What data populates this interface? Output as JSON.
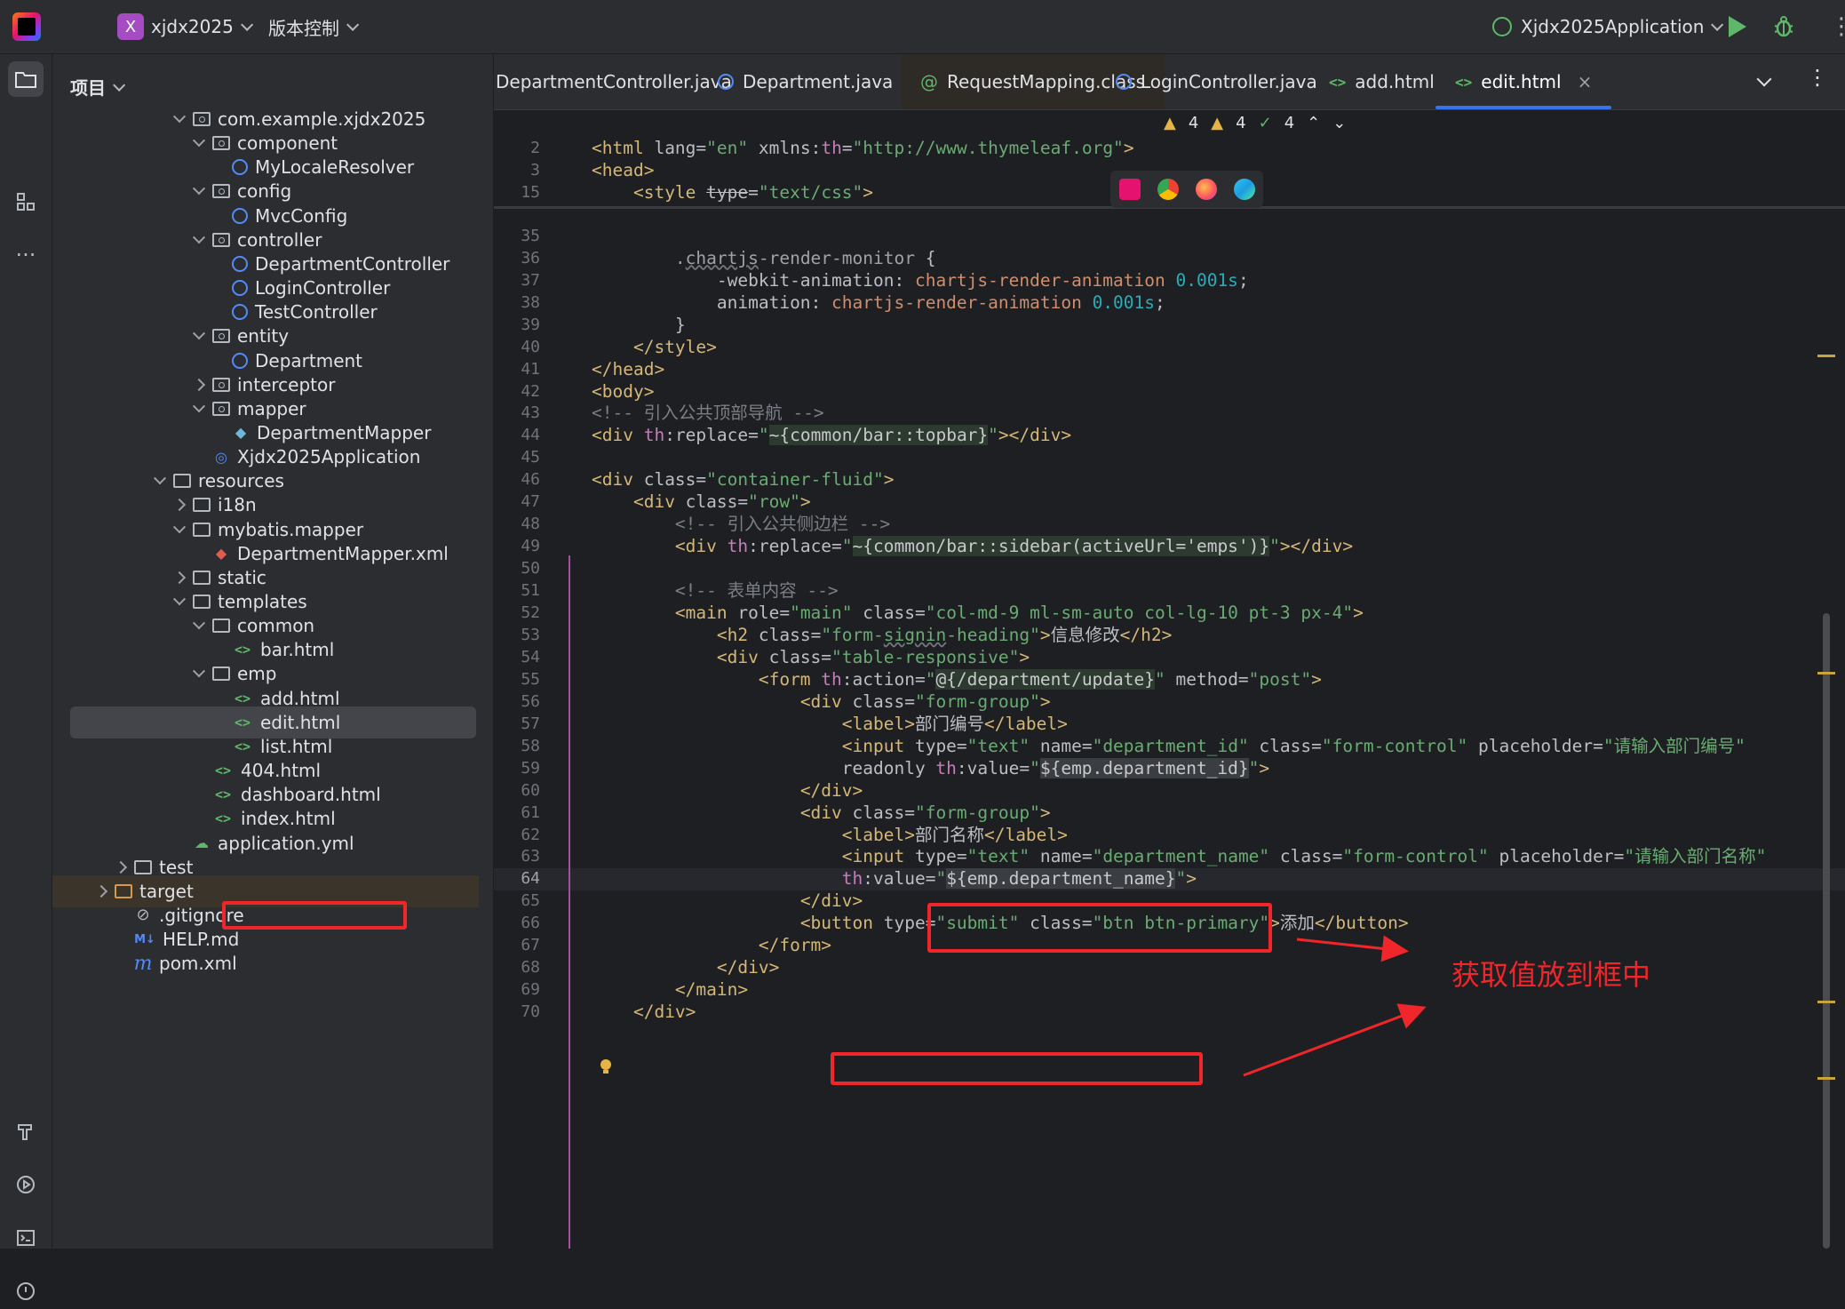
{
  "titlebar": {
    "project_badge": "X",
    "project_name": "xjdx2025",
    "vcs_label": "版本控制",
    "run_config": "Xjdx2025Application"
  },
  "project_panel": {
    "title": "项目",
    "tree": [
      {
        "label": "com.example.xjdx2025",
        "depth": 2,
        "arrow": "down",
        "icon": "package-folder"
      },
      {
        "label": "component",
        "depth": 3,
        "arrow": "down",
        "icon": "package-folder"
      },
      {
        "label": "MyLocaleResolver",
        "depth": 4,
        "arrow": "none",
        "icon": "class"
      },
      {
        "label": "config",
        "depth": 3,
        "arrow": "down",
        "icon": "package-folder"
      },
      {
        "label": "MvcConfig",
        "depth": 4,
        "arrow": "none",
        "icon": "class"
      },
      {
        "label": "controller",
        "depth": 3,
        "arrow": "down",
        "icon": "package-folder"
      },
      {
        "label": "DepartmentController",
        "depth": 4,
        "arrow": "none",
        "icon": "class"
      },
      {
        "label": "LoginController",
        "depth": 4,
        "arrow": "none",
        "icon": "class"
      },
      {
        "label": "TestController",
        "depth": 4,
        "arrow": "none",
        "icon": "class"
      },
      {
        "label": "entity",
        "depth": 3,
        "arrow": "down",
        "icon": "package-folder"
      },
      {
        "label": "Department",
        "depth": 4,
        "arrow": "none",
        "icon": "class"
      },
      {
        "label": "interceptor",
        "depth": 3,
        "arrow": "right",
        "icon": "package-folder"
      },
      {
        "label": "mapper",
        "depth": 3,
        "arrow": "down",
        "icon": "package-folder"
      },
      {
        "label": "DepartmentMapper",
        "depth": 4,
        "arrow": "none",
        "icon": "mapper"
      },
      {
        "label": "Xjdx2025Application",
        "depth": 3,
        "arrow": "none",
        "icon": "app"
      },
      {
        "label": "resources",
        "depth": 1,
        "arrow": "down",
        "icon": "folder"
      },
      {
        "label": "i18n",
        "depth": 2,
        "arrow": "right",
        "icon": "folder"
      },
      {
        "label": "mybatis.mapper",
        "depth": 2,
        "arrow": "down",
        "icon": "folder"
      },
      {
        "label": "DepartmentMapper.xml",
        "depth": 3,
        "arrow": "none",
        "icon": "xml"
      },
      {
        "label": "static",
        "depth": 2,
        "arrow": "right",
        "icon": "folder"
      },
      {
        "label": "templates",
        "depth": 2,
        "arrow": "down",
        "icon": "folder"
      },
      {
        "label": "common",
        "depth": 3,
        "arrow": "down",
        "icon": "folder"
      },
      {
        "label": "bar.html",
        "depth": 4,
        "arrow": "none",
        "icon": "html"
      },
      {
        "label": "emp",
        "depth": 3,
        "arrow": "down",
        "icon": "folder"
      },
      {
        "label": "add.html",
        "depth": 4,
        "arrow": "none",
        "icon": "html"
      },
      {
        "label": "edit.html",
        "depth": 4,
        "arrow": "none",
        "icon": "html",
        "selected": true
      },
      {
        "label": "list.html",
        "depth": 4,
        "arrow": "none",
        "icon": "html"
      },
      {
        "label": "404.html",
        "depth": 3,
        "arrow": "none",
        "icon": "html"
      },
      {
        "label": "dashboard.html",
        "depth": 3,
        "arrow": "none",
        "icon": "html"
      },
      {
        "label": "index.html",
        "depth": 3,
        "arrow": "none",
        "icon": "html"
      },
      {
        "label": "application.yml",
        "depth": 2,
        "arrow": "none",
        "icon": "yml"
      },
      {
        "label": "test",
        "depth": -1,
        "arrow": "right",
        "icon": "folder"
      },
      {
        "label": "target",
        "depth": -2,
        "arrow": "right",
        "icon": "folder-orange",
        "target": true
      },
      {
        "label": ".gitignore",
        "depth": -1,
        "arrow": "none",
        "icon": "git"
      },
      {
        "label": "HELP.md",
        "depth": -1,
        "arrow": "none",
        "icon": "md"
      },
      {
        "label": "pom.xml",
        "depth": -1,
        "arrow": "none",
        "icon": "pom"
      }
    ]
  },
  "tabs": [
    {
      "label": "DepartmentController.java",
      "icon": "class"
    },
    {
      "label": "Department.java",
      "icon": "class"
    },
    {
      "label": "RequestMapping.class",
      "icon": "annotation"
    },
    {
      "label": "LoginController.java",
      "icon": "class"
    },
    {
      "label": "add.html",
      "icon": "html"
    },
    {
      "label": "edit.html",
      "icon": "html",
      "active": true
    }
  ],
  "inspections": {
    "warn1": "4",
    "warn2": "4",
    "ok": "4"
  },
  "annotation_text": "获取值放到框中",
  "colors": {
    "annotation": "#f0262b",
    "accent": "#3574f0"
  },
  "code_lines": [
    {
      "n": "2",
      "html": "<span class=\"tg\">&lt;html</span> <span class=\"at\">lang=</span><span class=\"str\">\"en\"</span> <span class=\"at\">xmlns:</span><span class=\"ns\">th</span>=<span class=\"str\">\"http://www.thymeleaf.org\"</span><span class=\"tg\">&gt;</span>"
    },
    {
      "n": "3",
      "html": "<span class=\"tg\">&lt;head&gt;</span>"
    },
    {
      "n": "15",
      "html": "    <span class=\"tg\">&lt;style</span> <span class=\"at strike\">type</span>=<span class=\"str\">\"text/css\"</span><span class=\"tg\">&gt;</span>"
    },
    {
      "n": "35",
      "html": ""
    },
    {
      "n": "36",
      "html": "        <span class=\"sel\">.<span class=\"wave\">chartjs</span>-render-monitor</span> {"
    },
    {
      "n": "37",
      "html": "            <span class=\"prop\">-webkit-animation</span>: <span class=\"kw\">chartjs-render-animation</span> <span class=\"num\">0.001s</span>;"
    },
    {
      "n": "38",
      "html": "            <span class=\"prop\">animation</span>: <span class=\"kw\">chartjs-render-animation</span> <span class=\"num\">0.001s</span>;"
    },
    {
      "n": "39",
      "html": "        }"
    },
    {
      "n": "40",
      "html": "    <span class=\"tg\">&lt;/style&gt;</span>"
    },
    {
      "n": "41",
      "html": "<span class=\"tg\">&lt;/head&gt;</span>"
    },
    {
      "n": "42",
      "html": "<span class=\"tg\">&lt;body&gt;</span>"
    },
    {
      "n": "43",
      "html": "<span class=\"cm\">&lt;!-- 引入公共顶部导航 --&gt;</span>"
    },
    {
      "n": "44",
      "html": "<span class=\"tg\">&lt;div</span> <span class=\"ns\">th</span>:replace=<span class=\"str\">\"</span><span class=\"expr\">~{common/bar::topbar}</span><span class=\"str\">\"</span><span class=\"tg\">&gt;&lt;/div&gt;</span>"
    },
    {
      "n": "45",
      "html": ""
    },
    {
      "n": "46",
      "html": "<span class=\"tg\">&lt;div</span> class=<span class=\"str\">\"container-fluid\"</span><span class=\"tg\">&gt;</span>"
    },
    {
      "n": "47",
      "html": "    <span class=\"tg\">&lt;div</span> class=<span class=\"str\">\"row\"</span><span class=\"tg\">&gt;</span>"
    },
    {
      "n": "48",
      "html": "        <span class=\"cm\">&lt;!-- 引入公共侧边栏 --&gt;</span>"
    },
    {
      "n": "49",
      "html": "        <span class=\"tg\">&lt;div</span> <span class=\"ns\">th</span>:replace=<span class=\"str\">\"</span><span class=\"expr\">~{common/bar::sidebar(activeUrl='emps')}</span><span class=\"str\">\"</span><span class=\"tg\">&gt;&lt;/div&gt;</span>"
    },
    {
      "n": "50",
      "html": ""
    },
    {
      "n": "51",
      "html": "        <span class=\"cm\">&lt;!-- 表单内容 --&gt;</span>"
    },
    {
      "n": "52",
      "html": "        <span class=\"tg\">&lt;main</span> role=<span class=\"str\">\"main\"</span> class=<span class=\"str\">\"col-md-9 ml-sm-auto col-lg-10 pt-3 px-4\"</span><span class=\"tg\">&gt;</span>"
    },
    {
      "n": "53",
      "html": "            <span class=\"tg\">&lt;h2</span> class=<span class=\"str\">\"form-<span class=\"wave\">signin</span>-heading\"</span><span class=\"tg\">&gt;</span>信息修改<span class=\"tg\">&lt;/h2&gt;</span>"
    },
    {
      "n": "54",
      "html": "            <span class=\"tg\">&lt;div</span> class=<span class=\"str\">\"table-responsive\"</span><span class=\"tg\">&gt;</span>"
    },
    {
      "n": "55",
      "html": "                <span class=\"tg\">&lt;form</span> <span class=\"ns\">th</span>:action=<span class=\"str\">\"</span><span class=\"expr\">@{/department/update}</span><span class=\"str\">\"</span> method=<span class=\"str\">\"post\"</span><span class=\"tg\">&gt;</span>"
    },
    {
      "n": "56",
      "html": "                    <span class=\"tg\">&lt;div</span> class=<span class=\"str\">\"form-group\"</span><span class=\"tg\">&gt;</span>"
    },
    {
      "n": "57",
      "html": "                        <span class=\"tg\">&lt;label&gt;</span>部门编号<span class=\"tg\">&lt;/label&gt;</span>"
    },
    {
      "n": "58",
      "html": "                        <span class=\"tg\">&lt;input</span> type=<span class=\"str\">\"text\"</span> name=<span class=\"str\">\"department_id\"</span> class=<span class=\"str\">\"form-control\"</span> placeholder=<span class=\"str\">\"请输入部门编号\"</span>"
    },
    {
      "n": "59",
      "html": "                        readonly <span class=\"ns\">th</span>:value=<span class=\"str\">\"</span><span class=\"expr-hl\">${emp.department_id}</span><span class=\"str\">\"</span><span class=\"tg\">&gt;</span>"
    },
    {
      "n": "60",
      "html": "                    <span class=\"tg\">&lt;/div&gt;</span>"
    },
    {
      "n": "61",
      "html": "                    <span class=\"tg\">&lt;div</span> class=<span class=\"str\">\"form-group\"</span><span class=\"tg\">&gt;</span>"
    },
    {
      "n": "62",
      "html": "                        <span class=\"tg\">&lt;label&gt;</span>部门名称<span class=\"tg\">&lt;/label&gt;</span>"
    },
    {
      "n": "63",
      "html": "                        <span class=\"tg\">&lt;input</span> type=<span class=\"str\">\"text\"</span> name=<span class=\"str\">\"department_name\"</span> class=<span class=\"str\">\"form-control\"</span> placeholder=<span class=\"str\">\"请输入部门名称\"</span>"
    },
    {
      "n": "64",
      "html": "                        <span class=\"ns\">th</span>:value=<span class=\"str\">\"</span><span class=\"expr-hl\">${emp.department_name}</span><span class=\"str\">\"</span><span class=\"tg\">&gt;</span>",
      "current": true
    },
    {
      "n": "65",
      "html": "                    <span class=\"tg\">&lt;/div&gt;</span>"
    },
    {
      "n": "66",
      "html": "                    <span class=\"tg\">&lt;button</span> type=<span class=\"str\">\"submit\"</span> class=<span class=\"str\">\"btn btn-primary\"</span><span class=\"tg\">&gt;</span>添加<span class=\"tg\">&lt;/button&gt;</span>"
    },
    {
      "n": "67",
      "html": "                <span class=\"tg\">&lt;/form&gt;</span>"
    },
    {
      "n": "68",
      "html": "            <span class=\"tg\">&lt;/div&gt;</span>"
    },
    {
      "n": "69",
      "html": "        <span class=\"tg\">&lt;/main&gt;</span>"
    },
    {
      "n": "70",
      "html": "    <span class=\"tg\">&lt;/div&gt;</span>"
    }
  ]
}
